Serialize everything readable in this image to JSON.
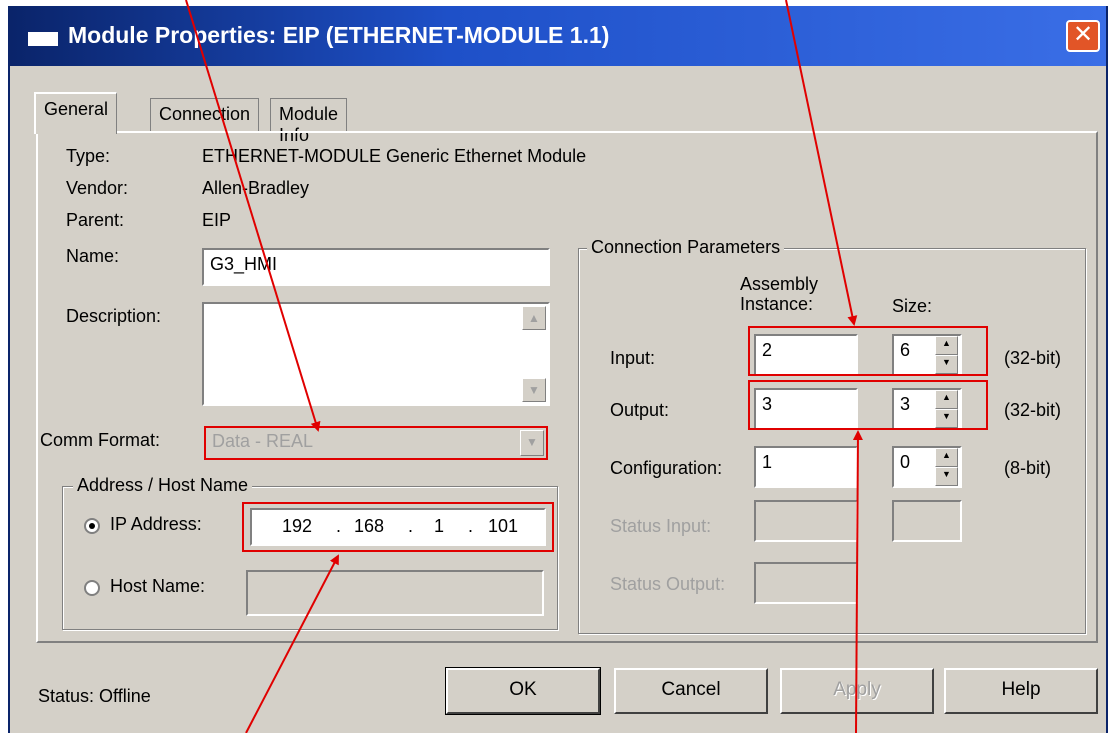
{
  "window": {
    "title": "Module Properties: EIP (ETHERNET-MODULE 1.1)"
  },
  "tabs": [
    {
      "label": "General"
    },
    {
      "label": "Connection"
    },
    {
      "label": "Module Info"
    }
  ],
  "general": {
    "type_label": "Type:",
    "type_value": "ETHERNET-MODULE Generic Ethernet Module",
    "vendor_label": "Vendor:",
    "vendor_value": "Allen-Bradley",
    "parent_label": "Parent:",
    "parent_value": "EIP",
    "name_label": "Name:",
    "name_value": "G3_HMI",
    "description_label": "Description:",
    "description_value": "",
    "comm_format_label": "Comm Format:",
    "comm_format_value": "Data - REAL"
  },
  "address": {
    "group_title": "Address / Host Name",
    "ip_label": "IP Address:",
    "ip_octets": [
      "192",
      "168",
      "1",
      "101"
    ],
    "host_label": "Host Name:",
    "host_value": ""
  },
  "connection_parameters": {
    "group_title": "Connection Parameters",
    "assembly_header_1": "Assembly",
    "assembly_header_2": "Instance:",
    "size_header": "Size:",
    "rows": [
      {
        "label": "Input:",
        "instance": "2",
        "size": "6",
        "unit": "(32-bit)"
      },
      {
        "label": "Output:",
        "instance": "3",
        "size": "3",
        "unit": "(32-bit)"
      },
      {
        "label": "Configuration:",
        "instance": "1",
        "size": "0",
        "unit": "(8-bit)"
      }
    ],
    "status_input_label": "Status Input:",
    "status_output_label": "Status Output:"
  },
  "footer": {
    "status_text": "Status:  Offline",
    "ok_label": "OK",
    "cancel_label": "Cancel",
    "apply_label": "Apply",
    "help_label": "Help"
  },
  "colors": {
    "annotation": "#e00000",
    "titlebar": "#0a246a"
  }
}
